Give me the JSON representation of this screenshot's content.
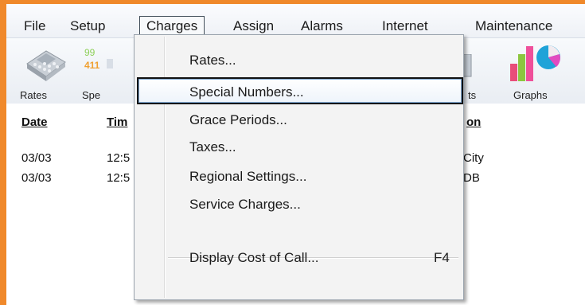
{
  "menubar": {
    "items": [
      "File",
      "Setup",
      "Charges",
      "Assign",
      "Alarms",
      "Internet",
      "Maintenance"
    ]
  },
  "toolbar": {
    "rates_label": "Rates",
    "special_label_partial": "Spe",
    "partial_label_ts": "ts",
    "graphs_label": "Graphs"
  },
  "list": {
    "headers": [
      "Date",
      "Tim",
      "on",
      "I"
    ],
    "rows": [
      {
        "date": "03/03",
        "time": "12:5",
        "location": "City"
      },
      {
        "date": "03/03",
        "time": "12:5",
        "location": "DB"
      }
    ]
  },
  "dropdown": {
    "items": [
      {
        "label": "Rates...",
        "shortcut": ""
      },
      {
        "label": "Special Numbers...",
        "shortcut": ""
      },
      {
        "label": "Grace Periods...",
        "shortcut": ""
      },
      {
        "label": "Taxes...",
        "shortcut": ""
      },
      {
        "label": "Regional Settings...",
        "shortcut": ""
      },
      {
        "label": "Service Charges...",
        "shortcut": ""
      },
      {
        "label": "Display Cost of Call...",
        "shortcut": "F4"
      }
    ],
    "highlighted_index": 1
  },
  "colors": {
    "frame_border": "#f0892b",
    "highlight_border": "#111111",
    "menu_bg": "#f3f3f3"
  }
}
